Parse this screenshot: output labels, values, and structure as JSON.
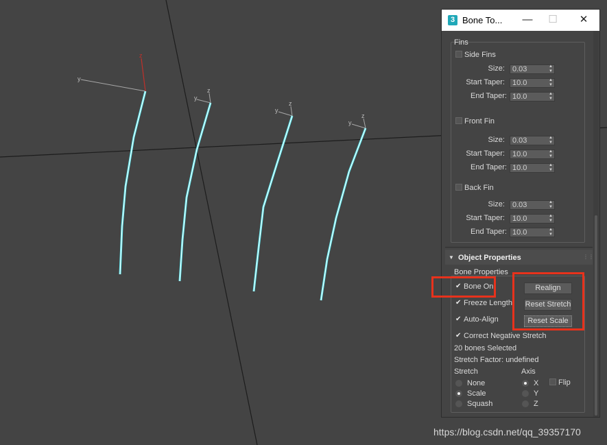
{
  "window": {
    "title": "Bone To...",
    "icon_text": "3",
    "minimize": "—",
    "maximize": "☐",
    "close": "✕"
  },
  "fins": {
    "group_title": "Fins",
    "side": {
      "label": "Side Fins",
      "checked": false,
      "size_label": "Size:",
      "size": "0.03",
      "start_label": "Start Taper:",
      "start": "10.0",
      "end_label": "End Taper:",
      "end": "10.0"
    },
    "front": {
      "label": "Front Fin",
      "checked": false,
      "size_label": "Size:",
      "size": "0.03",
      "start_label": "Start Taper:",
      "start": "10.0",
      "end_label": "End Taper:",
      "end": "10.0"
    },
    "back": {
      "label": "Back Fin",
      "checked": false,
      "size_label": "Size:",
      "size": "0.03",
      "start_label": "Start Taper:",
      "start": "10.0",
      "end_label": "End Taper:",
      "end": "10.0"
    }
  },
  "object_properties": {
    "rollout_title": "Object Properties",
    "group_title": "Bone Properties",
    "bone_on": {
      "label": "Bone On",
      "checked": true
    },
    "freeze_length": {
      "label": "Freeze Length",
      "checked": true
    },
    "auto_align": {
      "label": "Auto-Align",
      "checked": true
    },
    "correct_negative_stretch": {
      "label": "Correct Negative Stretch",
      "checked": true
    },
    "realign_button": "Realign",
    "reset_stretch_button": "Reset Stretch",
    "reset_scale_button": "Reset Scale",
    "bones_selected": "20 bones Selected",
    "stretch_factor": "Stretch Factor: undefined",
    "stretch": {
      "label": "Stretch",
      "options": [
        "None",
        "Scale",
        "Squash"
      ],
      "selected": "Scale"
    },
    "axis": {
      "label": "Axis",
      "options": [
        "X",
        "Y",
        "Z"
      ],
      "selected": "X",
      "flip_label": "Flip",
      "flip_checked": false
    }
  },
  "viewport": {
    "axis_labels": {
      "y": "y",
      "z": "z"
    },
    "bone_color": "#5ee8f0",
    "gizmo_z_color": "#c0302a"
  },
  "watermark": "https://blog.csdn.net/qq_39357170",
  "colors": {
    "highlight": "#e8321c",
    "viewport_bg": "#444444"
  }
}
